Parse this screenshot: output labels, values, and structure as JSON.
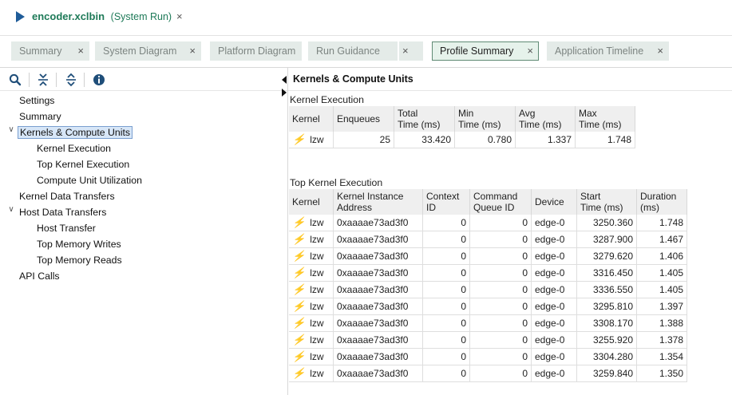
{
  "titlebar": {
    "title": "encoder.xclbin",
    "subtitle": "(System Run)",
    "close": "×"
  },
  "tabs": [
    {
      "label": "Summary",
      "active": false
    },
    {
      "label": "System Diagram",
      "active": false
    },
    {
      "label": "Platform Diagram",
      "active": false
    },
    {
      "label": "Run Guidance",
      "active": false
    },
    {
      "label": "Profile Summary",
      "active": true
    },
    {
      "label": "Application Timeline",
      "active": false
    }
  ],
  "tab_close": "×",
  "toolbar": {
    "icons": [
      "search-icon",
      "collapse-all-icon",
      "expand-all-icon",
      "info-icon"
    ]
  },
  "tree": [
    {
      "label": "Settings"
    },
    {
      "label": "Summary"
    },
    {
      "label": "Kernels & Compute Units"
    },
    {
      "label": "Kernel Execution"
    },
    {
      "label": "Top Kernel Execution"
    },
    {
      "label": "Compute Unit Utilization"
    },
    {
      "label": "Kernel Data Transfers"
    },
    {
      "label": "Host Data Transfers"
    },
    {
      "label": "Host Transfer"
    },
    {
      "label": "Top Memory Writes"
    },
    {
      "label": "Top Memory Reads"
    },
    {
      "label": "API Calls"
    }
  ],
  "panel": {
    "title": "Kernels & Compute Units"
  },
  "kernel_execution": {
    "label": "Kernel Execution",
    "headers": [
      "Kernel",
      "Enqueues",
      "Total\nTime (ms)",
      "Min\nTime (ms)",
      "Avg\nTime (ms)",
      "Max\nTime (ms)"
    ],
    "rows": [
      [
        "lzw",
        "25",
        "33.420",
        "0.780",
        "1.337",
        "1.748"
      ]
    ]
  },
  "top_kernel_execution": {
    "label": "Top Kernel Execution",
    "headers": [
      "Kernel",
      "Kernel Instance\nAddress",
      "Context\nID",
      "Command\nQueue ID",
      "Device",
      "Start\nTime (ms)",
      "Duration\n(ms)"
    ],
    "rows": [
      [
        "lzw",
        "0xaaaae73ad3f0",
        "0",
        "0",
        "edge-0",
        "3250.360",
        "1.748"
      ],
      [
        "lzw",
        "0xaaaae73ad3f0",
        "0",
        "0",
        "edge-0",
        "3287.900",
        "1.467"
      ],
      [
        "lzw",
        "0xaaaae73ad3f0",
        "0",
        "0",
        "edge-0",
        "3279.620",
        "1.406"
      ],
      [
        "lzw",
        "0xaaaae73ad3f0",
        "0",
        "0",
        "edge-0",
        "3316.450",
        "1.405"
      ],
      [
        "lzw",
        "0xaaaae73ad3f0",
        "0",
        "0",
        "edge-0",
        "3336.550",
        "1.405"
      ],
      [
        "lzw",
        "0xaaaae73ad3f0",
        "0",
        "0",
        "edge-0",
        "3295.810",
        "1.397"
      ],
      [
        "lzw",
        "0xaaaae73ad3f0",
        "0",
        "0",
        "edge-0",
        "3308.170",
        "1.388"
      ],
      [
        "lzw",
        "0xaaaae73ad3f0",
        "0",
        "0",
        "edge-0",
        "3255.920",
        "1.378"
      ],
      [
        "lzw",
        "0xaaaae73ad3f0",
        "0",
        "0",
        "edge-0",
        "3304.280",
        "1.354"
      ],
      [
        "lzw",
        "0xaaaae73ad3f0",
        "0",
        "0",
        "edge-0",
        "3259.840",
        "1.350"
      ]
    ]
  },
  "colors": {
    "title_green": "#1e7a58",
    "tab_bg": "#e4ebe8",
    "active_tab_border": "#5f8a74",
    "header_bg": "#efefef",
    "bolt": "#e7a52a",
    "selection": "#d7e6f7"
  }
}
